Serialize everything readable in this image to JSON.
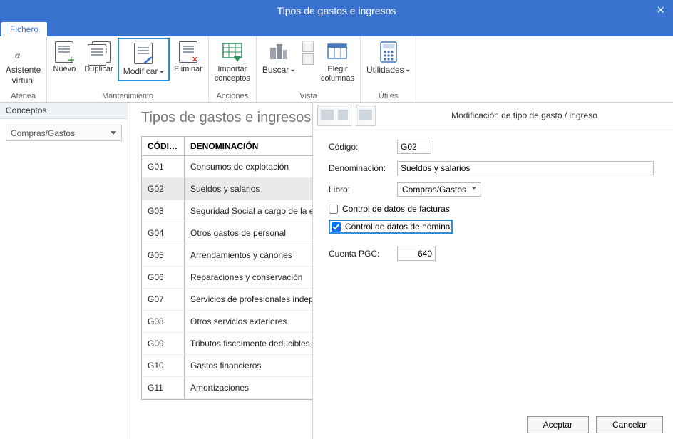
{
  "window": {
    "title": "Tipos de gastos e ingresos"
  },
  "tabs": {
    "fichero": "Fichero"
  },
  "ribbon": {
    "atenea": {
      "label": "Asistente\nvirtual",
      "group": "Atenea"
    },
    "nuevo": "Nuevo",
    "duplicar": "Duplicar",
    "modificar": "Modificar",
    "eliminar": "Eliminar",
    "mant_group": "Mantenimiento",
    "importar": "Importar\nconceptos",
    "acciones_group": "Acciones",
    "buscar": "Buscar",
    "elegir": "Elegir\ncolumnas",
    "vista_group": "Vista",
    "utilidades": "Utilidades",
    "utiles_group": "Útiles"
  },
  "sidebar": {
    "title": "Conceptos",
    "combo": "Compras/Gastos"
  },
  "main": {
    "title": "Tipos de gastos e ingresos",
    "cols": {
      "code": "CÓDI…",
      "denom": "DENOMINACIÓN"
    },
    "rows": [
      {
        "code": "G01",
        "denom": "Consumos de explotación"
      },
      {
        "code": "G02",
        "denom": "Sueldos y salarios"
      },
      {
        "code": "G03",
        "denom": "Seguridad Social a cargo de la e"
      },
      {
        "code": "G04",
        "denom": "Otros gastos de personal"
      },
      {
        "code": "G05",
        "denom": "Arrendamientos y cánones"
      },
      {
        "code": "G06",
        "denom": "Reparaciones y conservación"
      },
      {
        "code": "G07",
        "denom": "Servicios de profesionales indep"
      },
      {
        "code": "G08",
        "denom": "Otros servicios exteriores"
      },
      {
        "code": "G09",
        "denom": "Tributos fiscalmente deducibles"
      },
      {
        "code": "G10",
        "denom": "Gastos financieros"
      },
      {
        "code": "G11",
        "denom": "Amortizaciones"
      }
    ],
    "selected": "G02"
  },
  "dialog": {
    "title": "Modificación de tipo de gasto / ingreso",
    "labels": {
      "codigo": "Código:",
      "denom": "Denominación:",
      "libro": "Libro:",
      "chk_fact": "Control de datos de facturas",
      "chk_nom": "Control de datos de nómina",
      "cuenta": "Cuenta PGC:"
    },
    "values": {
      "codigo": "G02",
      "denom": "Sueldos y salarios",
      "libro": "Compras/Gastos",
      "chk_fact": false,
      "chk_nom": true,
      "cuenta": "640"
    },
    "buttons": {
      "ok": "Aceptar",
      "cancel": "Cancelar"
    }
  }
}
